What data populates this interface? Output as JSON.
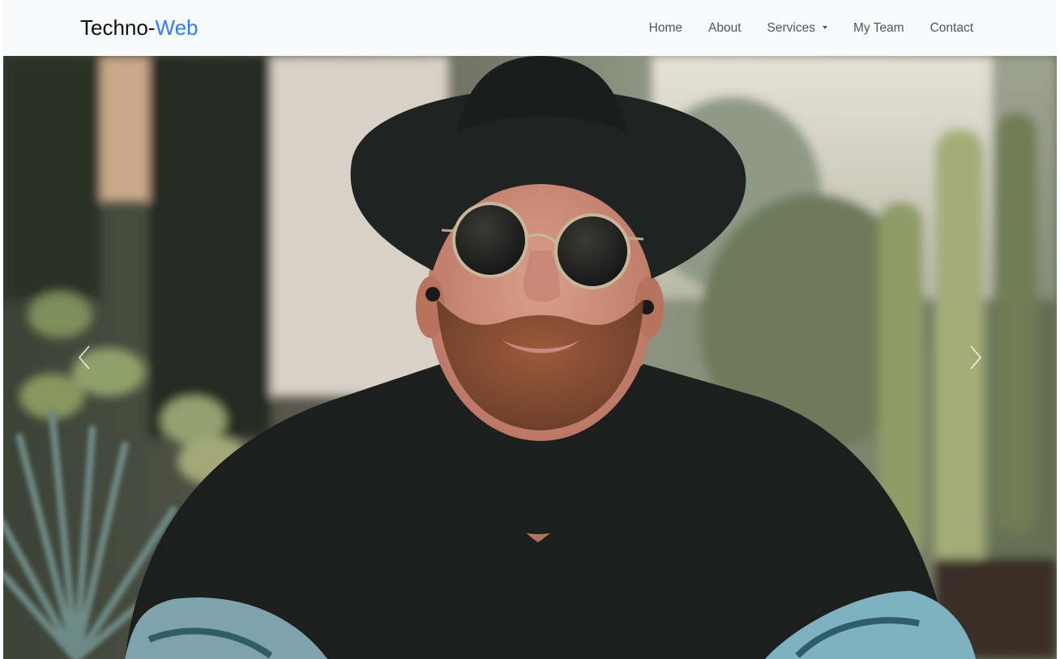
{
  "brand": {
    "part1": "Techno-",
    "part2": "Web",
    "accent_color": "#2f7cf6"
  },
  "nav": {
    "items": [
      {
        "label": "Home"
      },
      {
        "label": "About"
      },
      {
        "label": "Services",
        "has_dropdown": true
      },
      {
        "label": "My Team"
      },
      {
        "label": "Contact"
      }
    ]
  },
  "carousel": {
    "slide_image": "photo of a bearded man in a black fedora hat and round sunglasses, black t-shirt, tattooed arms, in front of a cactus garden",
    "prev_icon": "chevron-left-icon",
    "next_icon": "chevron-right-icon"
  }
}
